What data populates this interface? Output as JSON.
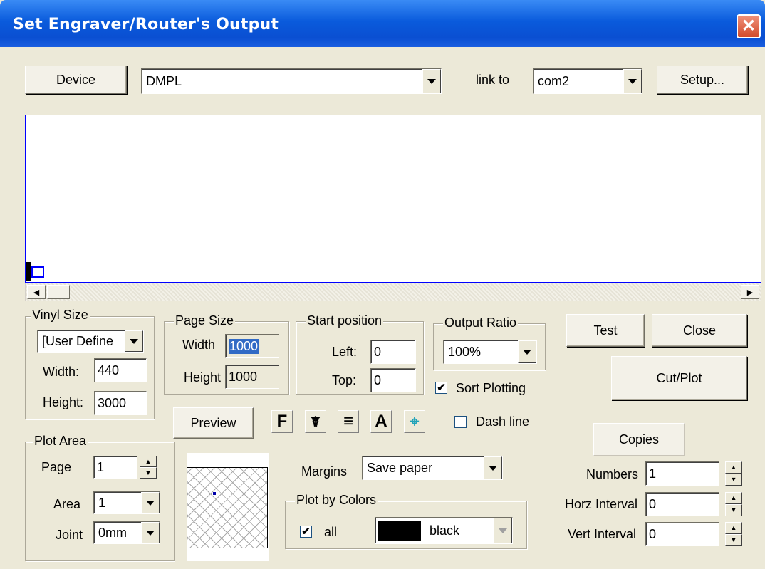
{
  "window": {
    "title": "Set Engraver/Router's Output",
    "close_glyph": "✕"
  },
  "top": {
    "device_button": "Device",
    "device_value": "DMPL",
    "link_label": "link to",
    "port_value": "com2",
    "setup_button": "Setup..."
  },
  "vinyl": {
    "legend": "Vinyl Size",
    "preset": "[User Define",
    "width_label": "Width:",
    "width": "440",
    "height_label": "Height:",
    "height": "3000"
  },
  "page": {
    "legend": "Page Size",
    "width_label": "Width",
    "width": "1000",
    "height_label": "Height",
    "height": "1000"
  },
  "start": {
    "legend": "Start position",
    "left_label": "Left:",
    "left": "0",
    "top_label": "Top:",
    "top": "0"
  },
  "ratio": {
    "legend": "Output Ratio",
    "value": "100%"
  },
  "sort_label": "Sort Plotting",
  "buttons": {
    "test": "Test",
    "close": "Close",
    "cutplot": "Cut/Plot",
    "preview": "Preview"
  },
  "toolbar": {
    "icons": [
      "F",
      "☤",
      "≡",
      "A",
      "⌖"
    ]
  },
  "dash_label": "Dash line",
  "plot_area": {
    "legend": "Plot Area",
    "page_label": "Page",
    "page": "1",
    "area_label": "Area",
    "area": "1",
    "joint_label": "Joint",
    "joint": "0mm"
  },
  "margins": {
    "label": "Margins",
    "value": "Save paper"
  },
  "plot_colors": {
    "legend": "Plot by Colors",
    "all_label": "all",
    "color_name": "black",
    "color_hex": "#000000"
  },
  "copies": {
    "button": "Copies",
    "numbers_label": "Numbers",
    "numbers": "1",
    "horz_label": "Horz Interval",
    "horz": "0",
    "vert_label": "Vert Interval",
    "vert": "0"
  },
  "colors": {
    "title_bar": "#0a5bdc",
    "preview_border": "#0000ff",
    "selection": "#316ac5"
  }
}
